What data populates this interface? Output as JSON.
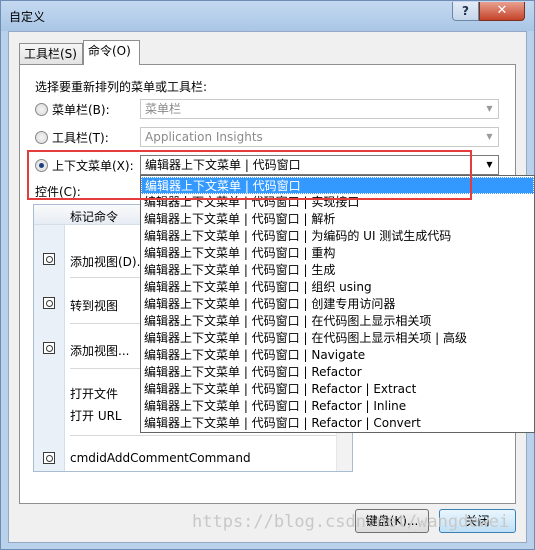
{
  "window": {
    "title": "自定义",
    "help_label": "?",
    "close_label": "✕"
  },
  "tabs": [
    {
      "label": "工具栏(S)"
    },
    {
      "label": "命令(O)"
    }
  ],
  "instruction": "选择要重新排列的菜单或工具栏:",
  "options": {
    "menubar": {
      "label": "菜单栏(B):",
      "value": "菜单栏"
    },
    "toolbar": {
      "label": "工具栏(T):",
      "value": "Application Insights"
    },
    "context_menu": {
      "label": "上下文菜单(X):",
      "value": "编辑器上下文菜单 | 代码窗口"
    }
  },
  "controls_label": "控件(C):",
  "controls_list": {
    "header": "标记命令",
    "items": [
      {
        "label": "添加视图(D)...",
        "icon": "view-icon"
      },
      {
        "label": "转到视图",
        "icon": "view-icon"
      },
      {
        "label": "添加视图...",
        "icon": "view-icon"
      },
      {
        "label": "打开文件",
        "icon": ""
      },
      {
        "label": "打开 URL",
        "icon": ""
      },
      {
        "label": "cmdidAddCommentCommand",
        "icon": "comment-icon"
      }
    ]
  },
  "dropdown_items": [
    "编辑器上下文菜单 | 代码窗口",
    "编辑器上下文菜单 | 代码窗口 | 实现接口",
    "编辑器上下文菜单 | 代码窗口 | 解析",
    "编辑器上下文菜单 | 代码窗口 | 为编码的 UI 测试生成代码",
    "编辑器上下文菜单 | 代码窗口 | 重构",
    "编辑器上下文菜单 | 代码窗口 | 生成",
    "编辑器上下文菜单 | 代码窗口 | 组织 using",
    "编辑器上下文菜单 | 代码窗口 | 创建专用访问器",
    "编辑器上下文菜单 | 代码窗口 | 在代码图上显示相关项",
    "编辑器上下文菜单 | 代码窗口 | 在代码图上显示相关项 | 高级",
    "编辑器上下文菜单 | 代码窗口 | Navigate",
    "编辑器上下文菜单 | 代码窗口 | Refactor",
    "编辑器上下文菜单 | 代码窗口 | Refactor | Extract",
    "编辑器上下文菜单 | 代码窗口 | Refactor | Inline",
    "编辑器上下文菜单 | 代码窗口 | Refactor | Convert"
  ],
  "buttons": {
    "keyboard": "键盘(K)...",
    "close": "关闭"
  },
  "watermark": "https://blog.csdn.net/wangdewei"
}
